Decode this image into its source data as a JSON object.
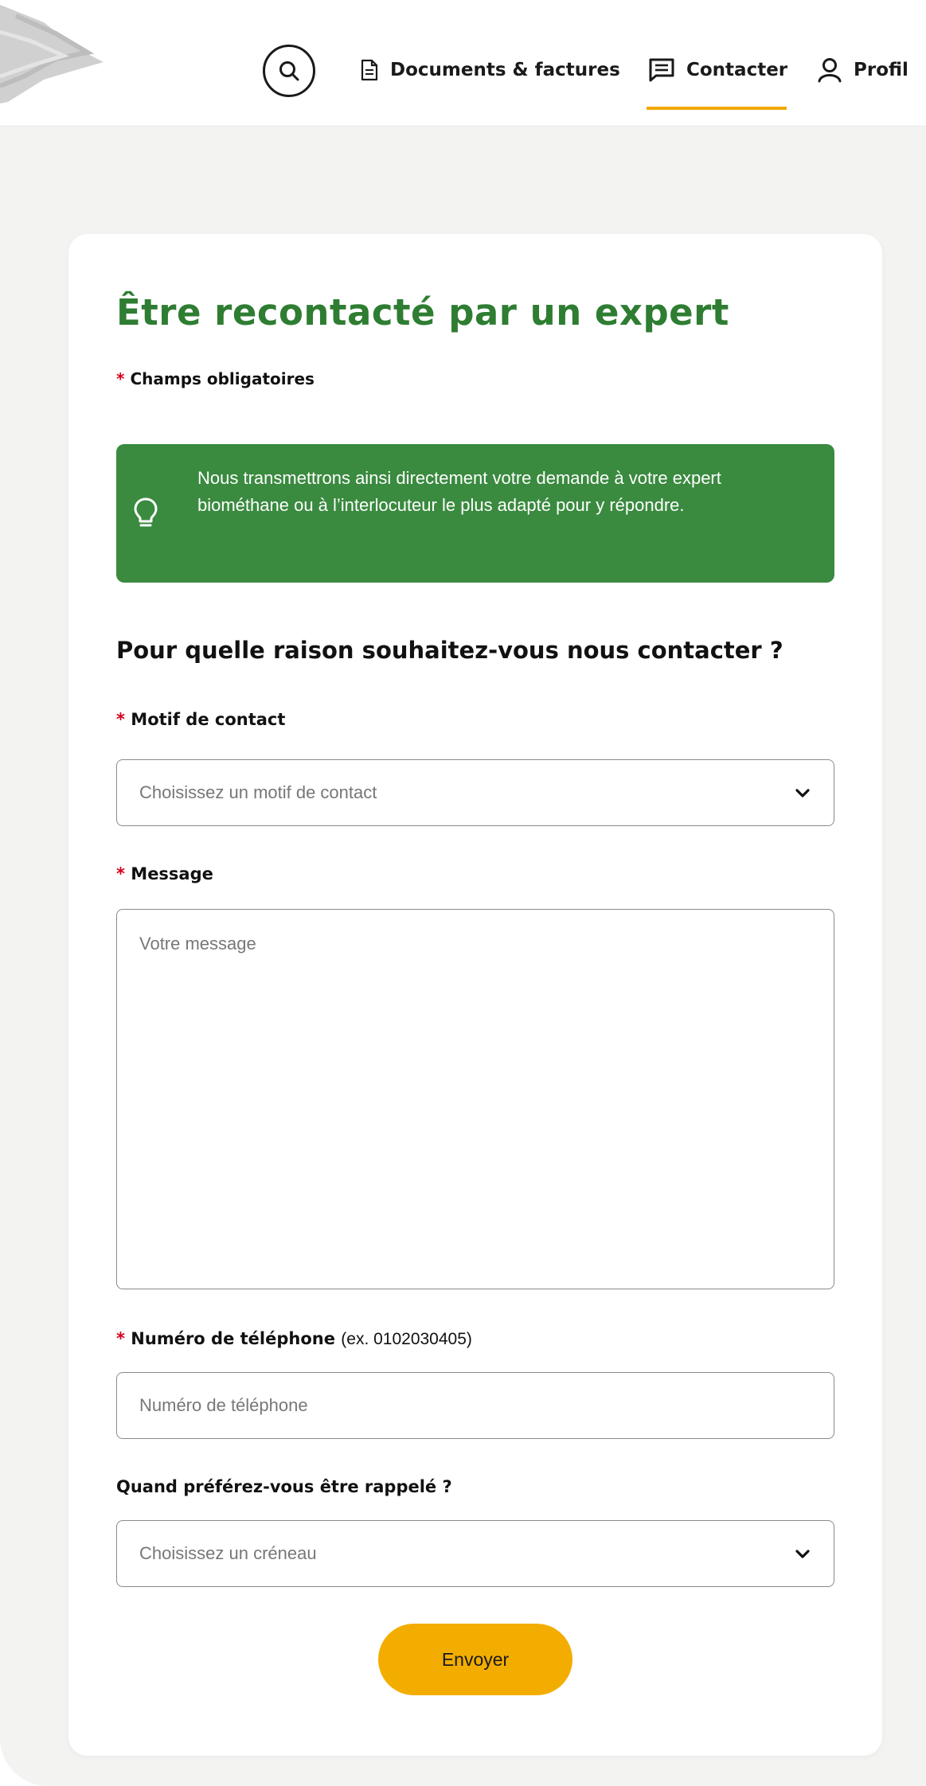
{
  "header": {
    "nav": {
      "documents_label": "Documents & factures",
      "contact_label": "Contacter",
      "profil_label": "Profil"
    },
    "active_tab_color": "#f2a900"
  },
  "form": {
    "title": "Être recontacté par un expert",
    "required_star": "*",
    "required_note": "Champs obligatoires",
    "info_text": "Nous transmettrons ainsi directement votre demande à votre expert biométhane ou à l’interlocuteur le plus adapté pour y répondre.",
    "section_heading": "Pour quelle raison souhaitez-vous nous contacter ?",
    "motif": {
      "label": "Motif de contact",
      "placeholder": "Choisissez un motif de contact"
    },
    "message": {
      "label": "Message",
      "placeholder": "Votre message"
    },
    "phone": {
      "label": "Numéro de téléphone",
      "hint": "(ex. 0102030405)",
      "placeholder": "Numéro de téléphone"
    },
    "callback": {
      "label": "Quand préférez-vous être rappelé ?",
      "placeholder": "Choisissez un créneau"
    },
    "submit_label": "Envoyer"
  },
  "colors": {
    "brand_green": "#2e7d32",
    "info_green": "#3a8a3f",
    "accent_yellow": "#f3ad00",
    "required_red": "#d6001c"
  },
  "icons": [
    "logo",
    "search-icon",
    "document-icon",
    "message-icon",
    "user-icon",
    "lightbulb-icon",
    "chevron-down-icon"
  ]
}
